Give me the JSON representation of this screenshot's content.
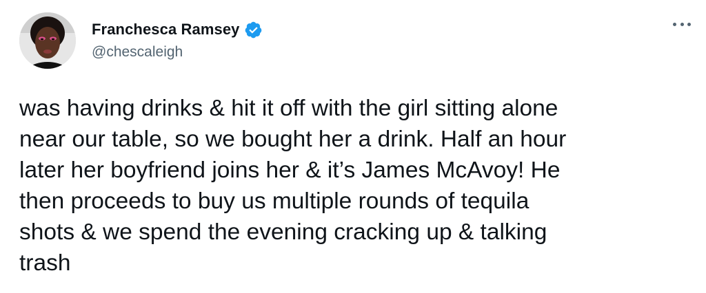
{
  "author": {
    "display_name": "Franchesca Ramsey",
    "handle": "@chescaleigh",
    "verified_icon": "verified-badge-icon",
    "verified_color": "#1d9bf0"
  },
  "menu": {
    "icon": "more-options-icon"
  },
  "tweet": {
    "lines": [
      "was having drinks & hit it off with the girl sitting alone",
      "near our table, so we bought her a drink. Half an hour",
      "later her boyfriend joins her & it’s James McAvoy! He",
      "then proceeds to buy us multiple rounds of tequila",
      "shots & we spend the evening cracking up & talking",
      "trash"
    ]
  },
  "colors": {
    "text": "#0f1419",
    "secondary": "#536471",
    "accent": "#1d9bf0"
  }
}
